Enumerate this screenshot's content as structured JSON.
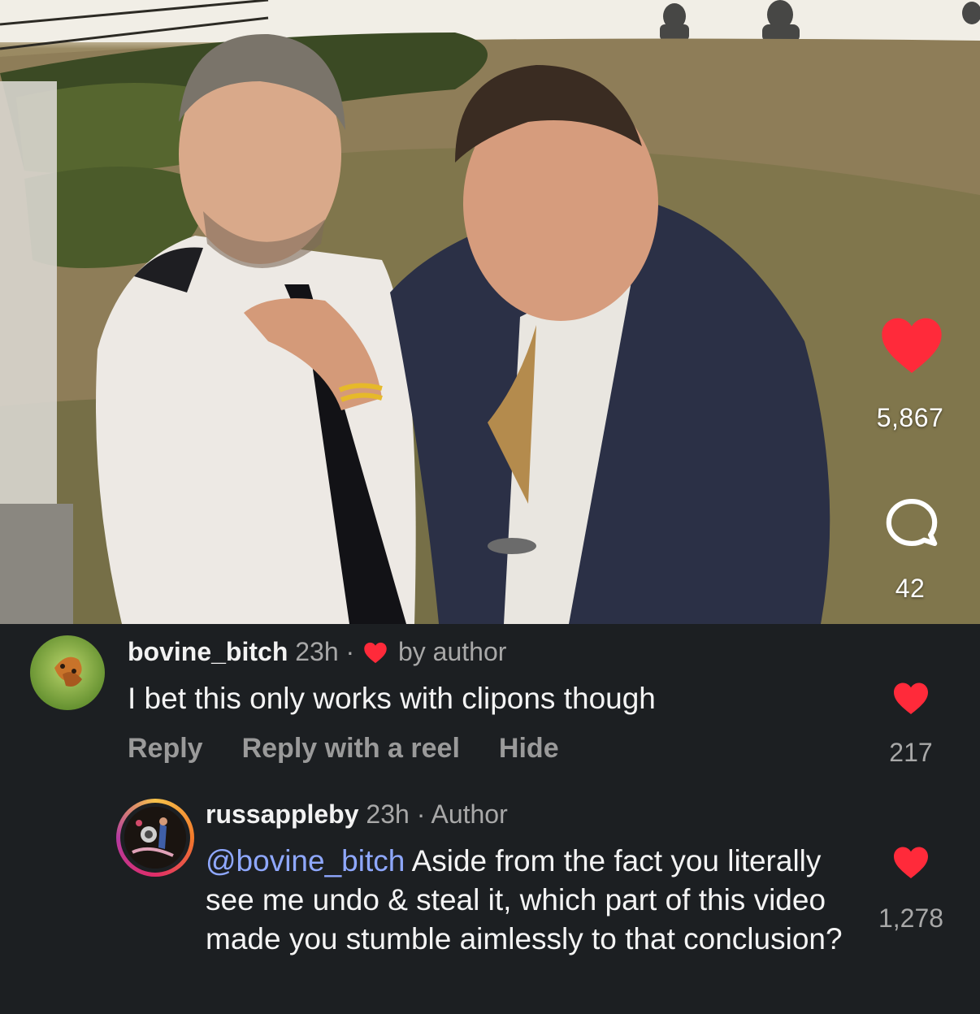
{
  "post": {
    "like_count": "5,867",
    "comment_count": "42",
    "icons": {
      "like": "heart-icon",
      "comment": "comment-bubble-icon"
    },
    "colors": {
      "like": "#ff2a3a"
    }
  },
  "comments": [
    {
      "username": "bovine_bitch",
      "time": "23h",
      "separator": "·",
      "liked_by_author_label": "by author",
      "text": "I bet this only works with clipons though",
      "actions": {
        "reply": "Reply",
        "reply_with_reel": "Reply with a reel",
        "hide": "Hide"
      },
      "like_count": "217"
    },
    {
      "username": "russappleby",
      "time": "23h",
      "separator": "·",
      "author_badge": "Author",
      "mention": "@bovine_bitch",
      "text": "Aside from the fact you literally see me undo & steal it, which part of this video made you stumble aimlessly to that conclusion?",
      "like_count": "1,278"
    }
  ],
  "theme": {
    "background": "#1c1f22",
    "mention": "#8fa8ff",
    "muted_text": "#a8a8a8"
  }
}
